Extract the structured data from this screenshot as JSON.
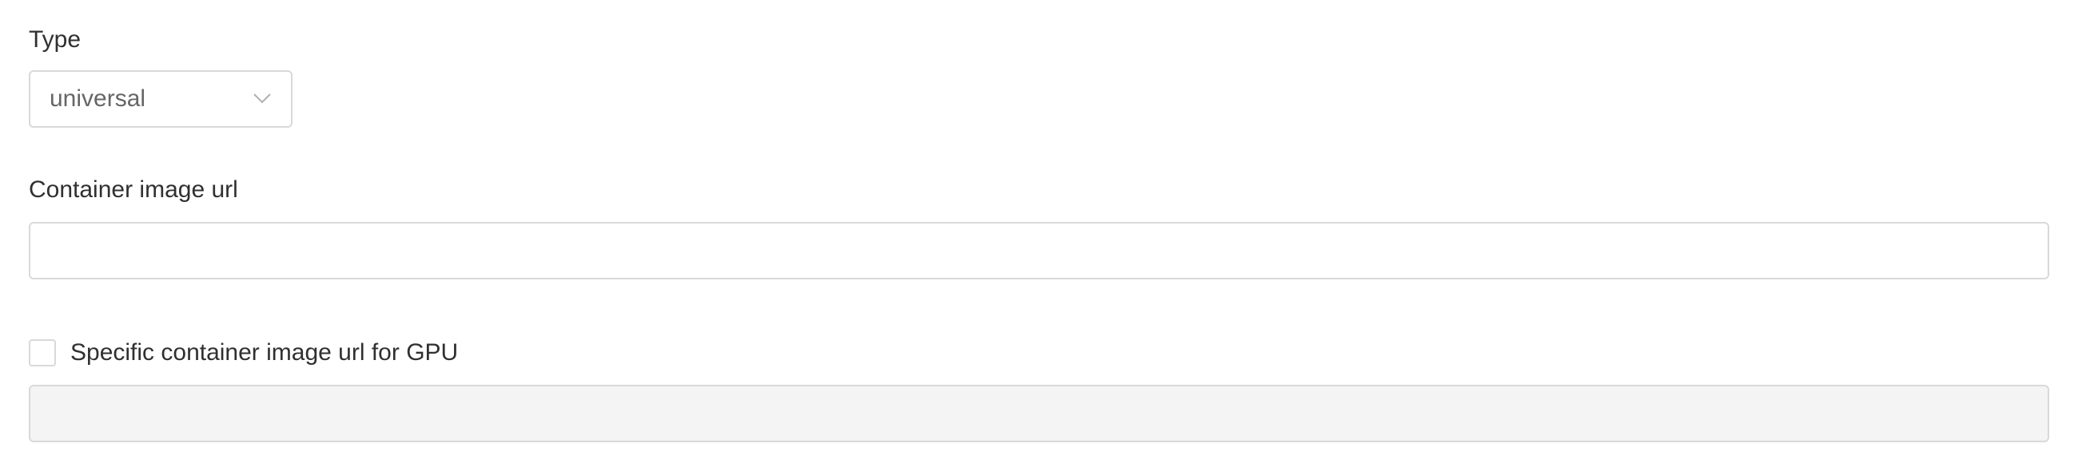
{
  "type_field": {
    "label": "Type",
    "selected_value": "universal",
    "chevron_icon": "chevron-down-icon"
  },
  "container_image_url": {
    "label": "Container image url",
    "value": "",
    "placeholder": ""
  },
  "gpu_option": {
    "checkbox_label": "Specific container image url for GPU",
    "checked": false
  },
  "gpu_container_image_url": {
    "value": "",
    "placeholder": "",
    "disabled": true
  },
  "colors": {
    "border": "#d9d9d9",
    "disabled_background": "#f4f4f4",
    "label_text": "#303030",
    "select_text": "#666666"
  }
}
